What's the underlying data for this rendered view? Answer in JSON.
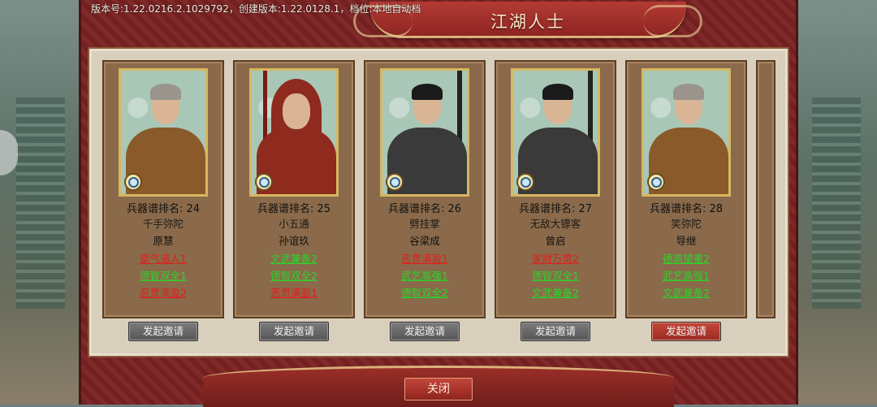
{
  "window": {
    "title": "江湖人士",
    "version_text": "版本号:1.22.0216.2.1029792，创建版本:1.22.0128.1，档位:本地自动档"
  },
  "cards": [
    {
      "rank": "兵器谱排名: 24",
      "nickname": "千手弥陀",
      "name": "原慧",
      "traits": [
        {
          "text": "豪气逼人1",
          "color": "red"
        },
        {
          "text": "德智双全1",
          "color": "green"
        },
        {
          "text": "恶贯满盈2",
          "color": "red"
        }
      ],
      "button": "发起邀请",
      "portrait": "monk-portrait"
    },
    {
      "rank": "兵器谱排名: 25",
      "nickname": "小五通",
      "name": "孙谊玖",
      "traits": [
        {
          "text": "文武兼备2",
          "color": "green"
        },
        {
          "text": "德智双全2",
          "color": "green"
        },
        {
          "text": "恶贯满盈1",
          "color": "red"
        }
      ],
      "button": "发起邀请",
      "portrait": "hooded-warrior-portrait"
    },
    {
      "rank": "兵器谱排名: 26",
      "nickname": "劈挂掌",
      "name": "谷梁成",
      "traits": [
        {
          "text": "恶贯满盈1",
          "color": "red"
        },
        {
          "text": "武艺高强1",
          "color": "green"
        },
        {
          "text": "德智双全2",
          "color": "green"
        }
      ],
      "button": "发起邀请",
      "portrait": "swordsman-portrait"
    },
    {
      "rank": "兵器谱排名: 27",
      "nickname": "无敌大镖客",
      "name": "曾启",
      "traits": [
        {
          "text": "家财万贯2",
          "color": "red"
        },
        {
          "text": "德智双全1",
          "color": "green"
        },
        {
          "text": "文武兼备2",
          "color": "green"
        }
      ],
      "button": "发起邀请",
      "portrait": "swordsman-portrait"
    },
    {
      "rank": "兵器谱排名: 28",
      "nickname": "笑弥陀",
      "name": "导继",
      "traits": [
        {
          "text": "德高望重2",
          "color": "green"
        },
        {
          "text": "武艺高强1",
          "color": "green"
        },
        {
          "text": "文武兼备2",
          "color": "green"
        }
      ],
      "button": "发起邀请",
      "portrait": "monk-portrait",
      "button_active": true
    }
  ],
  "footer": {
    "close_label": "关闭"
  },
  "colors": {
    "panel": "#7b2222",
    "inner": "#d9cfbd",
    "card": "#8a6a4a",
    "trait_red": "#e01e1e",
    "trait_green": "#2bd42b"
  }
}
